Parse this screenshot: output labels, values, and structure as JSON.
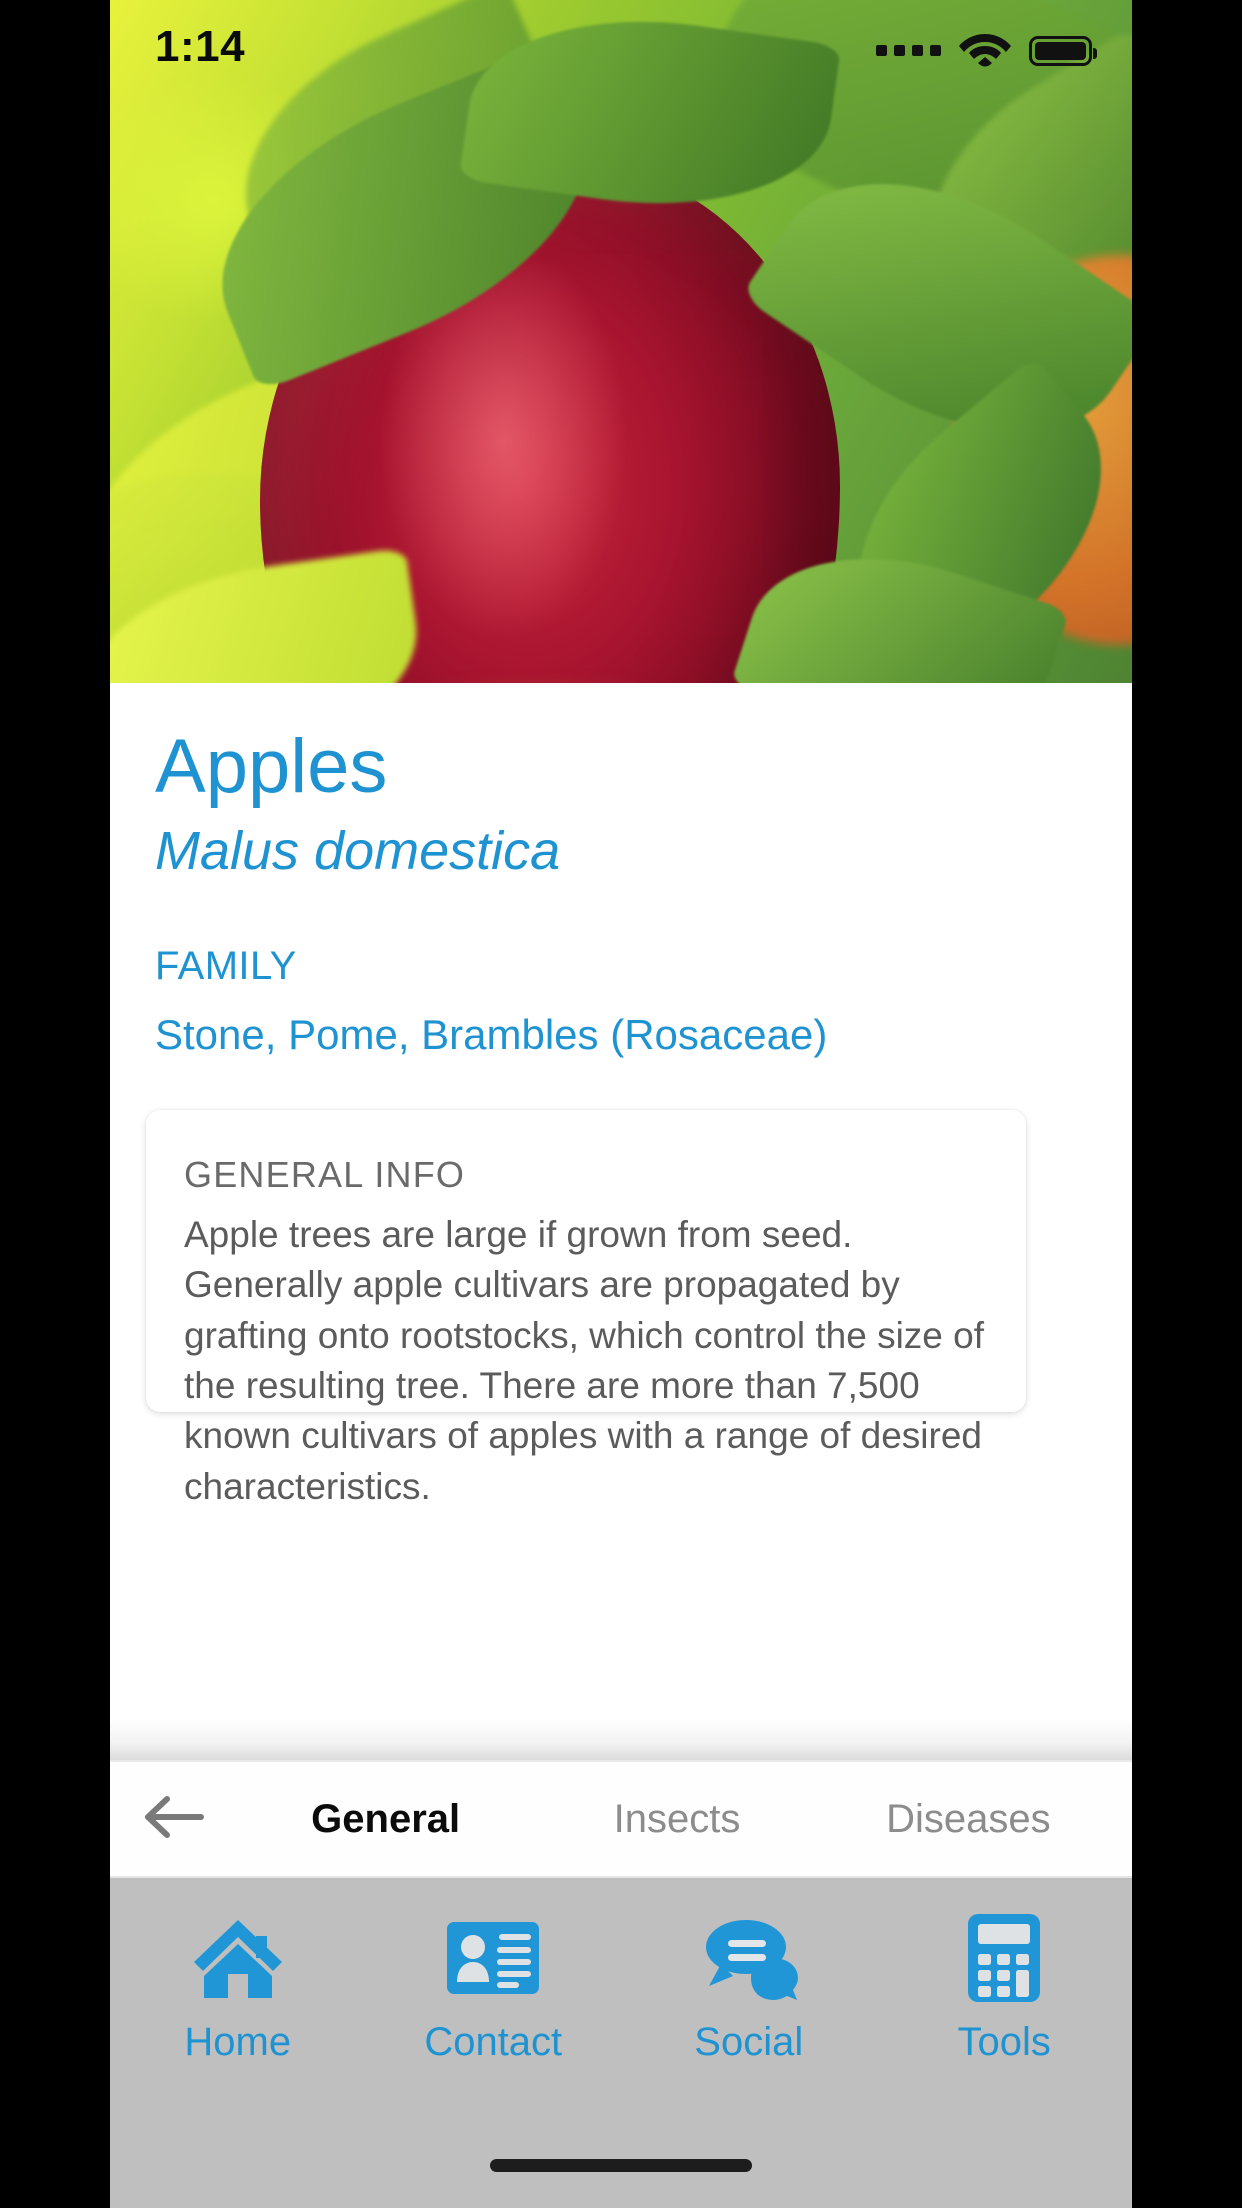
{
  "status_bar": {
    "time": "1:14",
    "signal_icon": "signal-dots-icon",
    "wifi_icon": "wifi-icon",
    "battery_icon": "battery-full-icon"
  },
  "hero": {
    "image_alt": "red apple hanging on tree with green leaves",
    "icon": "apple-photo"
  },
  "detail": {
    "plant_name": "Apples",
    "plant_latin_name": "Malus domestica",
    "family_label": "FAMILY",
    "family_value": "Stone, Pome, Brambles (Rosaceae)"
  },
  "info_card": {
    "title": "GENERAL INFO",
    "body": "Apple trees are large if grown from seed. Generally apple cultivars are propagated by grafting onto rootstocks, which control the size of the resulting tree. There are more than 7,500 known cultivars of apples with a range of desired characteristics."
  },
  "tab_bar": {
    "back_icon": "arrow-left-icon",
    "tabs": [
      {
        "label": "General",
        "active": true
      },
      {
        "label": "Insects",
        "active": false
      },
      {
        "label": "Diseases",
        "active": false
      }
    ]
  },
  "bottom_nav": {
    "items": [
      {
        "label": "Home",
        "icon": "home-icon"
      },
      {
        "label": "Contact",
        "icon": "contact-card-icon"
      },
      {
        "label": "Social",
        "icon": "speech-bubbles-icon"
      },
      {
        "label": "Tools",
        "icon": "calculator-icon"
      }
    ]
  },
  "colors": {
    "accent_blue": "#1f93d1",
    "nav_background": "#bfbfbf",
    "body_text": "#5b5b5b",
    "tab_inactive": "#8c8c8c"
  }
}
